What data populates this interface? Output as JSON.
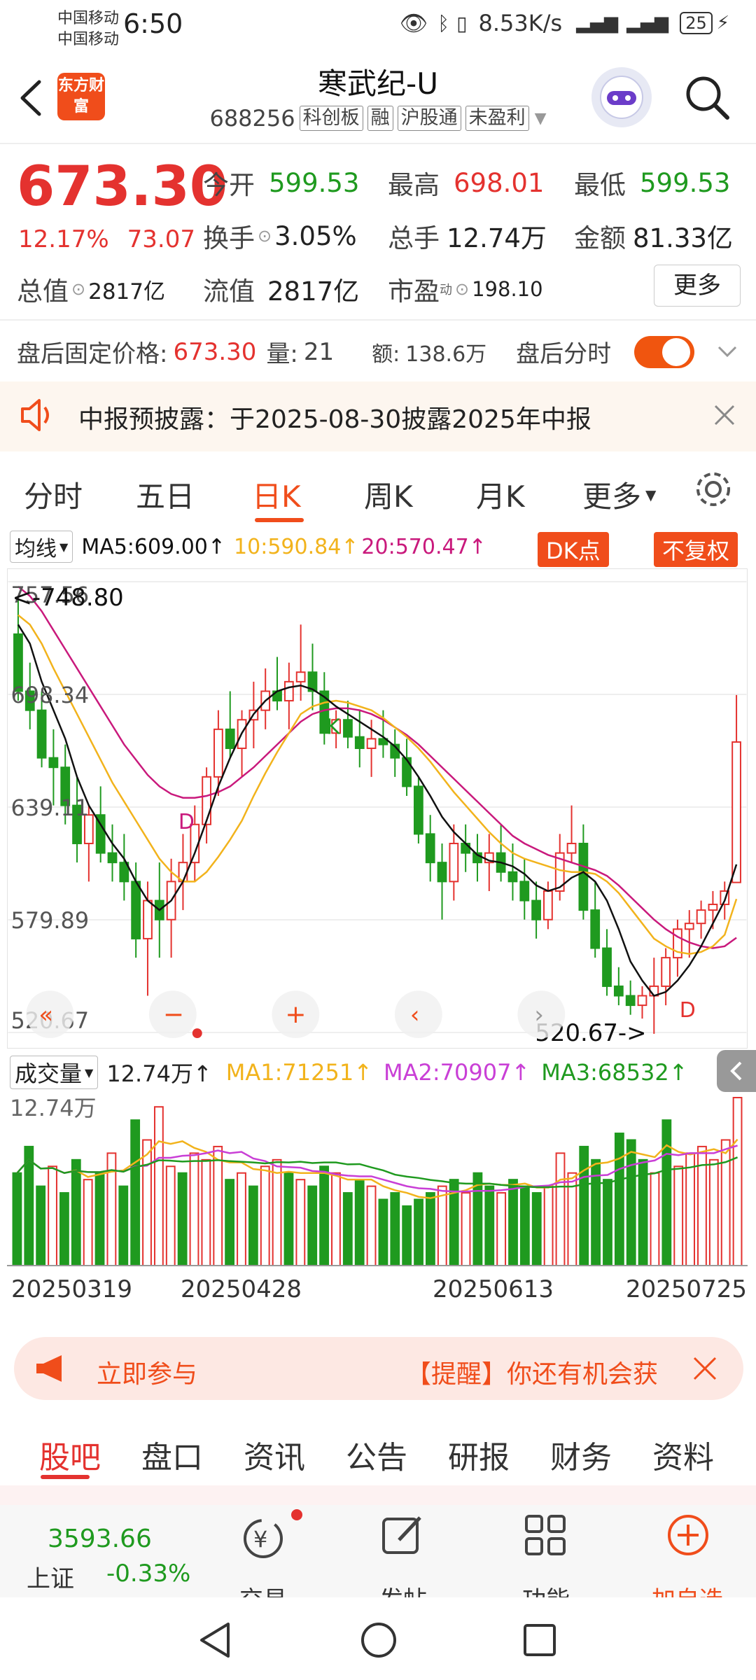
{
  "status": {
    "carrier1": "中国移动",
    "carrier2": "中国移动",
    "time": "6:50",
    "net_speed": "8.53K/s",
    "battery": "25"
  },
  "header": {
    "logo": "东方财富",
    "stock_name": "寒武纪-U",
    "code": "688256",
    "tags": [
      "科创板",
      "融",
      "沪股通",
      "未盈利"
    ]
  },
  "quote": {
    "price": "673.30",
    "pct": "12.17%",
    "change": "73.07",
    "open_label": "今开",
    "open": "599.53",
    "high_label": "最高",
    "high": "698.01",
    "low_label": "最低",
    "low": "599.53",
    "turnover_label": "换手",
    "turnover": "3.05%",
    "volume_label": "总手",
    "volume": "12.74万",
    "amount_label": "金额",
    "amount": "81.33亿",
    "mktcap_label": "总值",
    "mktcap": "2817亿",
    "float_label": "流值",
    "float": "2817亿",
    "pe_label": "市盈",
    "pe_sup": "动",
    "pe": "198.10",
    "more": "更多"
  },
  "after_hours": {
    "label": "盘后固定价格:",
    "price": "673.30",
    "qty_label": "量:",
    "qty": "21",
    "amt_label": "额:",
    "amt": "138.6万",
    "time_label": "盘后分时"
  },
  "notice": {
    "text": "中报预披露：于2025-08-30披露2025年中报"
  },
  "ktabs": [
    "分时",
    "五日",
    "日K",
    "周K",
    "月K",
    "更多"
  ],
  "ma_legend": {
    "select": "均线",
    "ma5": "MA5:609.00↑",
    "ma10": "10:590.84↑",
    "ma20": "20:570.47↑",
    "dk_btn": "DK点",
    "fq_btn": "不复权"
  },
  "chart_data": {
    "type": "candlestick",
    "y_ticks": [
      "757.56",
      "698.34",
      "639.11",
      "579.89",
      "520.67"
    ],
    "ylim": [
      520.67,
      757.56
    ],
    "max_label": "<-748.80",
    "min_label": "520.67->",
    "markers": [
      "D",
      "K",
      "D"
    ],
    "candles": [
      [
        730,
        748,
        695,
        700
      ],
      [
        700,
        715,
        680,
        690
      ],
      [
        690,
        700,
        660,
        665
      ],
      [
        665,
        680,
        640,
        660
      ],
      [
        660,
        672,
        630,
        640
      ],
      [
        640,
        655,
        610,
        620
      ],
      [
        620,
        640,
        600,
        635
      ],
      [
        635,
        650,
        610,
        615
      ],
      [
        615,
        630,
        600,
        610
      ],
      [
        610,
        625,
        590,
        600
      ],
      [
        600,
        610,
        560,
        570
      ],
      [
        570,
        600,
        540,
        590
      ],
      [
        590,
        610,
        560,
        580
      ],
      [
        580,
        612,
        560,
        600
      ],
      [
        600,
        625,
        585,
        610
      ],
      [
        610,
        640,
        600,
        630
      ],
      [
        630,
        660,
        620,
        655
      ],
      [
        655,
        690,
        645,
        680
      ],
      [
        680,
        700,
        665,
        670
      ],
      [
        670,
        690,
        655,
        685
      ],
      [
        685,
        705,
        670,
        690
      ],
      [
        690,
        712,
        680,
        700
      ],
      [
        700,
        718,
        690,
        695
      ],
      [
        695,
        715,
        680,
        705
      ],
      [
        705,
        735,
        695,
        710
      ],
      [
        710,
        725,
        690,
        700
      ],
      [
        700,
        710,
        672,
        678
      ],
      [
        678,
        690,
        670,
        685
      ],
      [
        685,
        695,
        670,
        676
      ],
      [
        676,
        690,
        660,
        670
      ],
      [
        670,
        685,
        655,
        675
      ],
      [
        675,
        690,
        665,
        672
      ],
      [
        672,
        680,
        655,
        665
      ],
      [
        665,
        675,
        645,
        650
      ],
      [
        650,
        655,
        620,
        625
      ],
      [
        625,
        635,
        600,
        610
      ],
      [
        610,
        620,
        580,
        600
      ],
      [
        600,
        630,
        590,
        620
      ],
      [
        620,
        630,
        605,
        615
      ],
      [
        615,
        625,
        600,
        610
      ],
      [
        610,
        625,
        595,
        615
      ],
      [
        615,
        630,
        600,
        605
      ],
      [
        605,
        620,
        590,
        600
      ],
      [
        600,
        612,
        580,
        590
      ],
      [
        590,
        600,
        570,
        580
      ],
      [
        580,
        600,
        575,
        595
      ],
      [
        595,
        625,
        590,
        615
      ],
      [
        615,
        640,
        610,
        620
      ],
      [
        620,
        630,
        580,
        585
      ],
      [
        585,
        600,
        560,
        565
      ],
      [
        565,
        575,
        540,
        545
      ],
      [
        545,
        555,
        535,
        540
      ],
      [
        540,
        548,
        530,
        535
      ],
      [
        535,
        545,
        528,
        540
      ],
      [
        540,
        560,
        520,
        545
      ],
      [
        545,
        565,
        535,
        560
      ],
      [
        560,
        580,
        550,
        575
      ],
      [
        575,
        585,
        560,
        578
      ],
      [
        578,
        590,
        570,
        585
      ],
      [
        585,
        595,
        575,
        588
      ],
      [
        588,
        600,
        580,
        595
      ],
      [
        599.53,
        698.01,
        599.53,
        673.3
      ]
    ],
    "ma5": [
      735,
      725,
      705,
      690,
      675,
      655,
      640,
      630,
      620,
      612,
      600,
      590,
      585,
      590,
      600,
      615,
      632,
      650,
      665,
      678,
      688,
      695,
      700,
      702,
      703,
      701,
      697,
      692,
      688,
      684,
      680,
      676,
      671,
      664,
      655,
      645,
      634,
      626,
      620,
      614,
      611,
      610,
      608,
      604,
      598,
      595,
      597,
      602,
      605,
      600,
      590,
      575,
      558,
      548,
      540,
      542,
      548,
      556,
      566,
      578,
      590,
      609
    ],
    "ma10": [
      740,
      735,
      725,
      712,
      700,
      688,
      676,
      664,
      652,
      642,
      632,
      622,
      612,
      605,
      600,
      600,
      605,
      613,
      622,
      632,
      645,
      657,
      668,
      678,
      688,
      692,
      694,
      695,
      694,
      692,
      690,
      686,
      681,
      676,
      670,
      663,
      655,
      647,
      640,
      633,
      626,
      620,
      615,
      612,
      610,
      608,
      606,
      605,
      605,
      604,
      600,
      594,
      586,
      578,
      570,
      566,
      563,
      562,
      563,
      566,
      572,
      590.84
    ],
    "ma20": [
      755,
      750,
      742,
      732,
      722,
      712,
      702,
      692,
      682,
      672,
      664,
      656,
      650,
      646,
      644,
      644,
      645,
      647,
      650,
      655,
      660,
      666,
      672,
      678,
      684,
      688,
      690,
      691,
      691,
      690,
      688,
      685,
      681,
      677,
      672,
      666,
      660,
      654,
      648,
      642,
      636,
      630,
      624,
      620,
      617,
      614,
      612,
      610,
      608,
      606,
      603,
      598,
      592,
      586,
      580,
      575,
      571,
      568,
      566,
      565,
      566,
      570.47
    ]
  },
  "volume": {
    "select": "成交量",
    "value": "12.74万↑",
    "ma1": "MA1:71251↑",
    "ma2": "MA2:70907↑",
    "ma3": "MA3:68532↑",
    "max_label": "12.74万",
    "max": 127400,
    "bars": [
      70,
      90,
      60,
      75,
      55,
      80,
      65,
      70,
      85,
      60,
      110,
      95,
      120,
      75,
      70,
      85,
      80,
      90,
      65,
      70,
      60,
      75,
      80,
      70,
      65,
      60,
      75,
      70,
      55,
      65,
      60,
      50,
      55,
      45,
      50,
      55,
      60,
      65,
      55,
      70,
      60,
      55,
      65,
      60,
      55,
      60,
      85,
      70,
      90,
      80,
      65,
      100,
      95,
      80,
      70,
      110,
      75,
      85,
      90,
      80,
      95,
      127
    ],
    "bar_up": [
      false,
      false,
      false,
      true,
      false,
      false,
      true,
      false,
      true,
      false,
      false,
      true,
      true,
      true,
      false,
      true,
      true,
      true,
      false,
      true,
      false,
      true,
      true,
      false,
      true,
      false,
      false,
      true,
      false,
      false,
      true,
      false,
      false,
      false,
      false,
      false,
      true,
      false,
      true,
      false,
      false,
      true,
      false,
      false,
      false,
      true,
      true,
      true,
      false,
      false,
      false,
      false,
      false,
      false,
      true,
      false,
      true,
      true,
      true,
      true,
      true,
      true
    ],
    "dates": [
      "20250319",
      "20250428",
      "20250613",
      "20250725"
    ]
  },
  "banner": {
    "join": "立即参与",
    "text": "【提醒】你还有机会获"
  },
  "bottom_tabs": [
    "股吧",
    "盘口",
    "资讯",
    "公告",
    "研报",
    "财务",
    "资料"
  ],
  "nav": {
    "index_value": "3593.66",
    "index_name": "上证",
    "index_pct": "-0.33%",
    "items": [
      "交易",
      "发帖",
      "功能",
      "加自选"
    ]
  },
  "colors": {
    "up": "#e4322f",
    "down": "#1f9a1f",
    "accent": "#f04d1b",
    "ma5": "#111111",
    "ma10": "#f2b31c",
    "ma20": "#c9197c"
  }
}
